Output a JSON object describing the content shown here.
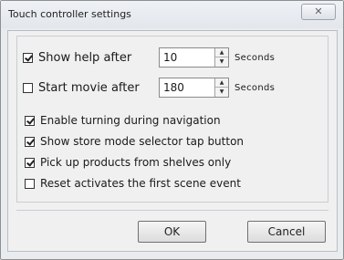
{
  "window": {
    "title": "Touch controller settings",
    "close_glyph": "✕"
  },
  "settings": {
    "show_help": {
      "label": "Show help after",
      "checked": true,
      "value": "10",
      "unit": "Seconds"
    },
    "start_movie": {
      "label": "Start movie after",
      "checked": false,
      "value": "180",
      "unit": "Seconds"
    },
    "options": [
      {
        "label": "Enable turning during navigation",
        "checked": true
      },
      {
        "label": "Show store mode selector tap button",
        "checked": true
      },
      {
        "label": "Pick up products from shelves only",
        "checked": true
      },
      {
        "label": "Reset activates the first scene event",
        "checked": false
      }
    ]
  },
  "buttons": {
    "ok": "OK",
    "cancel": "Cancel"
  },
  "icons": {
    "spin_up": "▲",
    "spin_down": "▼"
  }
}
